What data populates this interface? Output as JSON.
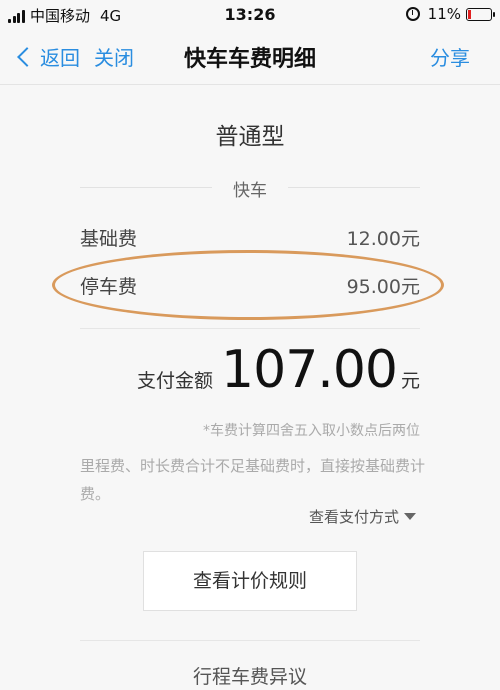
{
  "status_bar": {
    "carrier": "中国移动",
    "network": "4G",
    "time": "13:26",
    "battery": "11%"
  },
  "nav": {
    "back_label": "返回",
    "close_label": "关闭",
    "title": "快车车费明细",
    "share_label": "分享"
  },
  "trip": {
    "car_type": "普通型",
    "section_label": "快车"
  },
  "fees": [
    {
      "name": "基础费",
      "value": "12.00元"
    },
    {
      "name": "停车费",
      "value": "95.00元"
    }
  ],
  "total": {
    "label": "支付金额",
    "value": "107.00",
    "unit": "元"
  },
  "note": "*车费计算四舍五入取小数点后两位",
  "description": "里程费、时长费合计不足基础费时，直接按基础费计费。",
  "payment_method_link": "查看支付方式",
  "rules_button": "查看计价规则",
  "dispute_link": "行程车费异议",
  "colors": {
    "accent": "#2a8de0",
    "highlight_circle": "#d99a5c"
  }
}
